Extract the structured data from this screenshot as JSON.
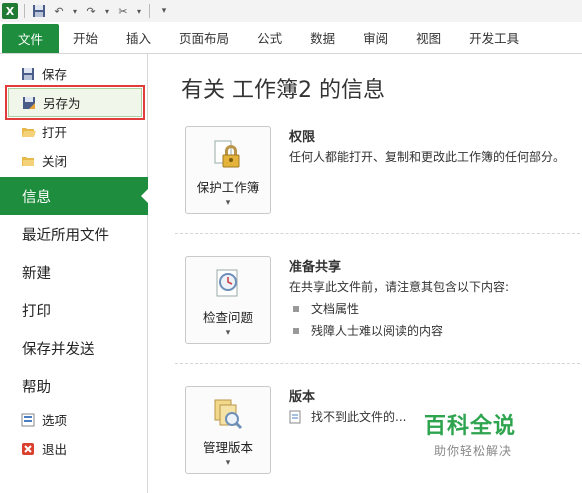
{
  "qat": {
    "app_icon": "X"
  },
  "tabs": [
    {
      "label": "文件"
    },
    {
      "label": "开始"
    },
    {
      "label": "插入"
    },
    {
      "label": "页面布局"
    },
    {
      "label": "公式"
    },
    {
      "label": "数据"
    },
    {
      "label": "审阅"
    },
    {
      "label": "视图"
    },
    {
      "label": "开发工具"
    }
  ],
  "nav": {
    "save": "保存",
    "save_as": "另存为",
    "open": "打开",
    "close": "关闭",
    "info": "信息",
    "recent": "最近所用文件",
    "new": "新建",
    "print": "打印",
    "save_send": "保存并发送",
    "help": "帮助",
    "options": "选项",
    "exit": "退出"
  },
  "main": {
    "title": "有关 工作簿2 的信息",
    "permissions": {
      "button_label": "保护工作簿",
      "heading": "权限",
      "description": "任何人都能打开、复制和更改此工作簿的任何部分。"
    },
    "prepare": {
      "button_label": "检查问题",
      "heading": "准备共享",
      "description": "在共享此文件前，请注意其包含以下内容:",
      "items": [
        "文档属性",
        "残障人士难以阅读的内容"
      ]
    },
    "versions": {
      "button_label": "管理版本",
      "heading": "版本",
      "description": "找不到此文件的..."
    }
  },
  "watermark": {
    "line1": "百科全说",
    "line2": "助你轻松解决"
  },
  "colors": {
    "accent": "#1e8e3e",
    "highlight_box": "#e03c3c"
  }
}
